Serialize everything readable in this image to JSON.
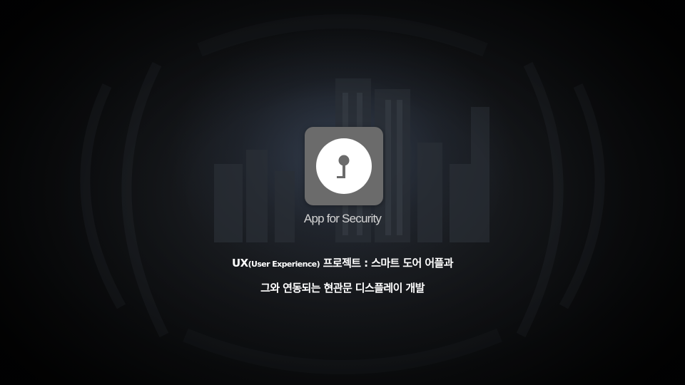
{
  "app": {
    "icon_name": "keyhole-lock-icon",
    "label": "App for Security"
  },
  "description": {
    "line1_prefix": "UX",
    "line1_paren": "(User Experience)",
    "line1_rest": "프로젝트 : 스마트 도어  어플과",
    "line2": "그와 연동되는 현관문 디스플레이 개발"
  },
  "colors": {
    "icon_bg": "#6b6b6b",
    "icon_circle": "#ffffff",
    "text": "#ffffff"
  }
}
